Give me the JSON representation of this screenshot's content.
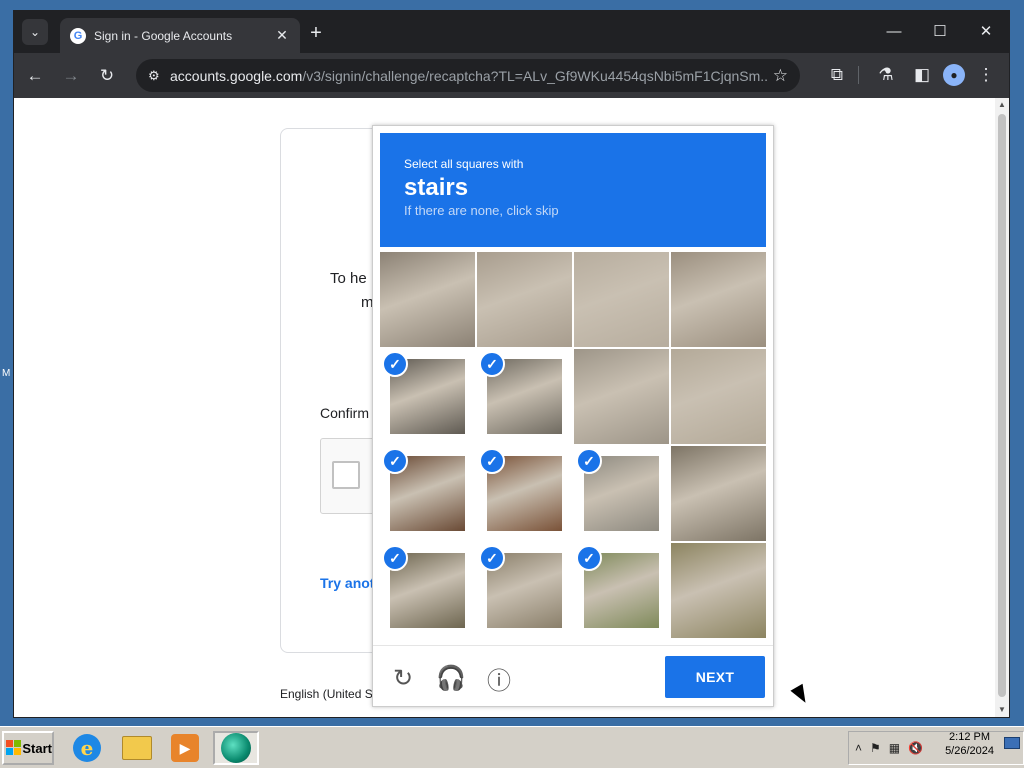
{
  "browser": {
    "tab_title": "Sign in - Google Accounts",
    "tab_favicon": "G",
    "url_host": "accounts.google.com",
    "url_path": "/v3/signin/challenge/recaptcha?TL=ALv_Gf9WKu4454qsNbi5mF1CjqnSm...",
    "new_tab": "+",
    "close_tab": "✕"
  },
  "signin": {
    "text_partial_1": "To he",
    "text_partial_2": "m",
    "confirm_partial": "Confirm",
    "try_another_partial": "Try anot",
    "language_partial": "English (United S"
  },
  "captcha": {
    "line1": "Select all squares with",
    "keyword": "stairs",
    "line3": "If there are none, click skip",
    "next_label": "NEXT",
    "header_color": "#1a73e8",
    "tiles_selected": [
      [
        false,
        false,
        false,
        false
      ],
      [
        true,
        true,
        false,
        false
      ],
      [
        true,
        true,
        true,
        false
      ],
      [
        true,
        true,
        true,
        false
      ]
    ]
  },
  "desktop": {
    "left_edge_text": "M"
  },
  "taskbar": {
    "start_label": "Start",
    "clock_time": "2:12 PM",
    "clock_date": "5/26/2024"
  }
}
